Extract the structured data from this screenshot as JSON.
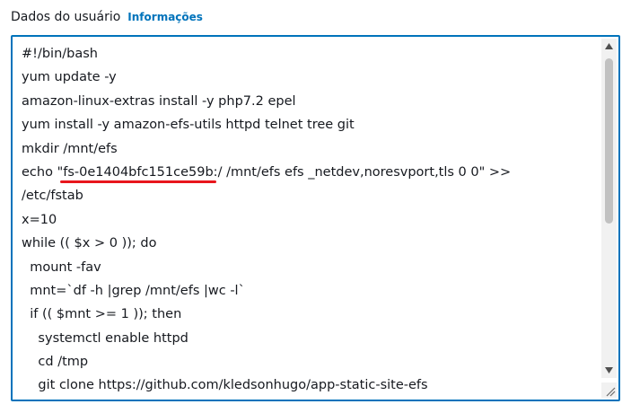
{
  "field": {
    "label": "Dados do usuário",
    "info_link": "Informações"
  },
  "user_data": {
    "lines": [
      "#!/bin/bash",
      "yum update -y",
      "amazon-linux-extras install -y php7.2 epel",
      "yum install -y amazon-efs-utils httpd telnet tree git",
      "mkdir /mnt/efs",
      "echo \"fs-0e1404bfc151ce59b:/ /mnt/efs efs _netdev,noresvport,tls 0 0\" >>",
      "/etc/fstab",
      "x=10",
      "while (( $x > 0 )); do",
      "  mount -fav",
      "  mnt=`df -h |grep /mnt/efs |wc -l`",
      "  if (( $mnt >= 1 )); then",
      "    systemctl enable httpd",
      "    cd /tmp",
      "    git clone https://github.com/kledsonhugo/app-static-site-efs"
    ],
    "highlighted_text": "fs-0e1404bfc151ce59b:"
  },
  "colors": {
    "border_focus": "#0073bb",
    "link": "#0073bb",
    "highlight_underline": "#e8161c",
    "scrollbar_track": "#f1f1f1",
    "scrollbar_thumb": "#c1c1c1"
  },
  "icons": {
    "scroll_up": "triangle-up-icon",
    "scroll_down": "triangle-down-icon",
    "resize": "resize-grip-icon"
  }
}
